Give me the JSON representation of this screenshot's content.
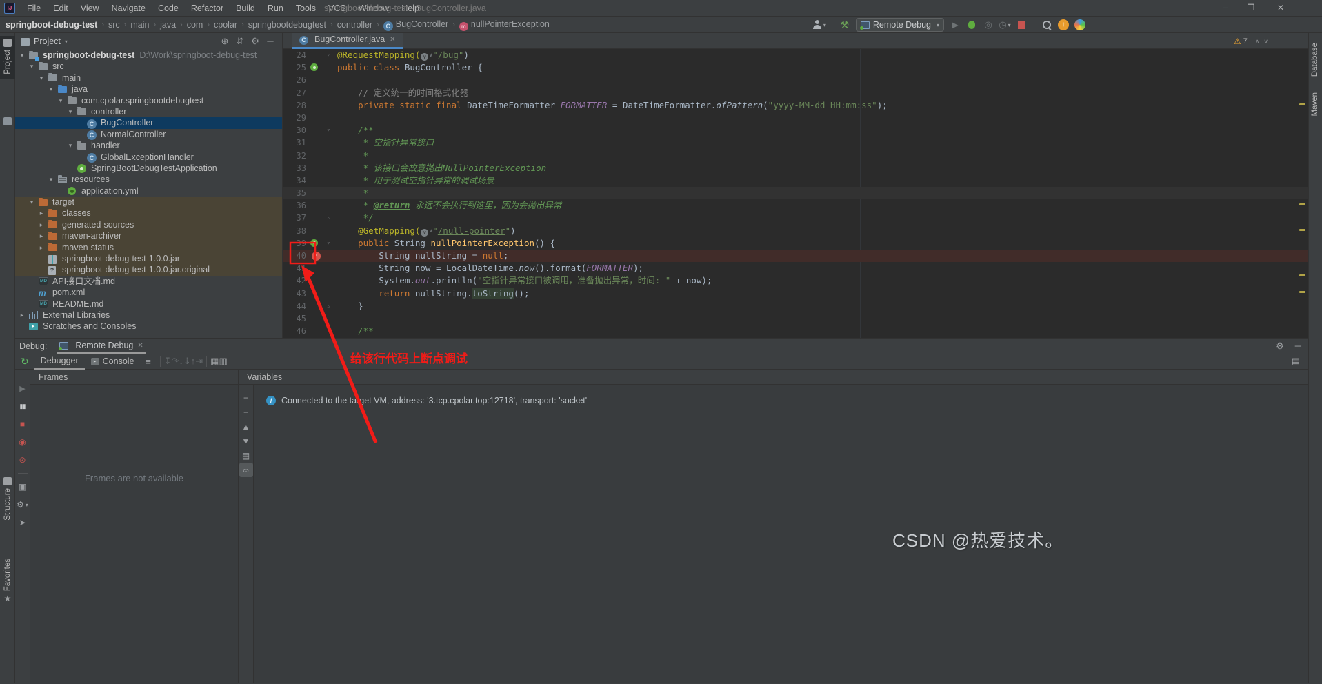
{
  "window": {
    "title": "springboot-debug-test - BugController.java",
    "menus": [
      "File",
      "Edit",
      "View",
      "Navigate",
      "Code",
      "Refactor",
      "Build",
      "Run",
      "Tools",
      "VCS",
      "Window",
      "Help"
    ],
    "controls": {
      "minimize": "─",
      "maximize": "❐",
      "close": "✕"
    }
  },
  "breadcrumbs": [
    {
      "label": "springboot-debug-test",
      "bold": true
    },
    {
      "label": "src"
    },
    {
      "label": "main"
    },
    {
      "label": "java"
    },
    {
      "label": "com"
    },
    {
      "label": "cpolar"
    },
    {
      "label": "springbootdebugtest"
    },
    {
      "label": "controller"
    },
    {
      "label": "BugController",
      "icon": "class"
    },
    {
      "label": "nullPointerException",
      "icon": "method"
    }
  ],
  "toolbar": {
    "run_config": "Remote Debug"
  },
  "left_stripe": {
    "project": "Project",
    "structure": "Structure",
    "favorites": "Favorites"
  },
  "right_stripe": {
    "database": "Database",
    "maven": "Maven"
  },
  "project_panel": {
    "title": "Project",
    "header_icons": [
      {
        "name": "locate-file-icon",
        "glyph": "⊕"
      },
      {
        "name": "collapse-all-icon",
        "glyph": "⇵"
      },
      {
        "name": "panel-settings-icon",
        "glyph": "⚙"
      },
      {
        "name": "hide-panel-icon",
        "glyph": "─"
      }
    ],
    "tree": [
      {
        "label": "springboot-debug-test",
        "suffix": "D:\\Work\\springboot-debug-test",
        "indent": 0,
        "chevron": "open",
        "icon": "project",
        "bold": true
      },
      {
        "label": "src",
        "indent": 1,
        "chevron": "open",
        "icon": "folder"
      },
      {
        "label": "main",
        "indent": 2,
        "chevron": "open",
        "icon": "folder"
      },
      {
        "label": "java",
        "indent": 3,
        "chevron": "open",
        "icon": "folder-src"
      },
      {
        "label": "com.cpolar.springbootdebugtest",
        "indent": 4,
        "chevron": "open",
        "icon": "package"
      },
      {
        "label": "controller",
        "indent": 5,
        "chevron": "open",
        "icon": "package"
      },
      {
        "label": "BugController",
        "indent": 6,
        "icon": "class",
        "selected": true
      },
      {
        "label": "NormalController",
        "indent": 6,
        "icon": "class"
      },
      {
        "label": "handler",
        "indent": 5,
        "chevron": "open",
        "icon": "package"
      },
      {
        "label": "GlobalExceptionHandler",
        "indent": 6,
        "icon": "class"
      },
      {
        "label": "SpringBootDebugTestApplication",
        "indent": 5,
        "icon": "springboot"
      },
      {
        "label": "resources",
        "indent": 3,
        "chevron": "open",
        "icon": "folder-res"
      },
      {
        "label": "application.yml",
        "indent": 4,
        "icon": "yml"
      },
      {
        "label": "target",
        "indent": 1,
        "chevron": "open",
        "icon": "folder-excl",
        "excluded": true
      },
      {
        "label": "classes",
        "indent": 2,
        "chevron": "closed",
        "icon": "folder-excl",
        "excluded": true
      },
      {
        "label": "generated-sources",
        "indent": 2,
        "chevron": "closed",
        "icon": "folder-excl",
        "excluded": true
      },
      {
        "label": "maven-archiver",
        "indent": 2,
        "chevron": "closed",
        "icon": "folder-excl",
        "excluded": true
      },
      {
        "label": "maven-status",
        "indent": 2,
        "chevron": "closed",
        "icon": "folder-excl",
        "excluded": true
      },
      {
        "label": "springboot-debug-test-1.0.0.jar",
        "indent": 2,
        "icon": "jar",
        "excluded": true
      },
      {
        "label": "springboot-debug-test-1.0.0.jar.original",
        "indent": 2,
        "icon": "file-q",
        "excluded": true
      },
      {
        "label": "API接口文档.md",
        "indent": 1,
        "icon": "md"
      },
      {
        "label": "pom.xml",
        "indent": 1,
        "icon": "maven"
      },
      {
        "label": "README.md",
        "indent": 1,
        "icon": "md"
      },
      {
        "label": "External Libraries",
        "indent": 0,
        "chevron": "closed",
        "icon": "libs"
      },
      {
        "label": "Scratches and Consoles",
        "indent": 0,
        "icon": "scratch"
      }
    ]
  },
  "editor": {
    "tab": "BugController.java",
    "inspections": {
      "warning_count": "7"
    },
    "lines": [
      {
        "n": 24,
        "gut": [
          "fold-open"
        ],
        "seg": [
          [
            "ann",
            "@RequestMapping("
          ],
          [
            "ico",
            ""
          ],
          [
            "str",
            "\""
          ],
          [
            "stru",
            "/bug"
          ],
          [
            "str",
            "\""
          ],
          [
            "plain",
            ")"
          ]
        ]
      },
      {
        "n": 25,
        "gut": [
          "spring"
        ],
        "seg": [
          [
            "kw",
            "public class "
          ],
          [
            "plain",
            "BugController {"
          ]
        ]
      },
      {
        "n": 26,
        "seg": []
      },
      {
        "n": 27,
        "seg": [
          [
            "cmt",
            "    // 定义统一的时间格式化器"
          ]
        ]
      },
      {
        "n": 28,
        "seg": [
          [
            "kw",
            "    private static final "
          ],
          [
            "plain",
            "DateTimeFormatter "
          ],
          [
            "field",
            "FORMATTER "
          ],
          [
            "plain",
            "= DateTimeFormatter."
          ],
          [
            "it",
            "ofPattern"
          ],
          [
            "plain",
            "("
          ],
          [
            "str",
            "\"yyyy-MM-dd HH:mm:ss\""
          ],
          [
            "plain",
            ");"
          ]
        ]
      },
      {
        "n": 29,
        "seg": []
      },
      {
        "n": 30,
        "gut": [
          "fold-open"
        ],
        "seg": [
          [
            "doc",
            "    /**"
          ]
        ]
      },
      {
        "n": 31,
        "seg": [
          [
            "doc",
            "     * 空指针异常接口"
          ]
        ]
      },
      {
        "n": 32,
        "seg": [
          [
            "doc",
            "     *"
          ]
        ]
      },
      {
        "n": 33,
        "seg": [
          [
            "doc",
            "     * 该接口会故意抛出NullPointerException"
          ]
        ]
      },
      {
        "n": 34,
        "seg": [
          [
            "doc",
            "     * 用于测试空指针异常的调试场景"
          ]
        ]
      },
      {
        "n": 35,
        "cur": true,
        "seg": [
          [
            "doc",
            "     *"
          ]
        ]
      },
      {
        "n": 36,
        "seg": [
          [
            "doc",
            "     * "
          ],
          [
            "doctag",
            "@return"
          ],
          [
            "doc",
            " 永远不会执行到这里，因为会抛出异常"
          ]
        ]
      },
      {
        "n": 37,
        "gut": [
          "fold-close"
        ],
        "seg": [
          [
            "doc",
            "     */"
          ]
        ]
      },
      {
        "n": 38,
        "seg": [
          [
            "ann",
            "    @GetMapping("
          ],
          [
            "ico",
            ""
          ],
          [
            "str",
            "\""
          ],
          [
            "stru",
            "/null-pointer"
          ],
          [
            "str",
            "\""
          ],
          [
            "plain",
            ")"
          ]
        ]
      },
      {
        "n": 39,
        "gut": [
          "spring",
          "fold-open"
        ],
        "seg": [
          [
            "kw",
            "    public "
          ],
          [
            "plain",
            "String "
          ],
          [
            "meth",
            "nullPointerException"
          ],
          [
            "plain",
            "() {"
          ]
        ]
      },
      {
        "n": 40,
        "bp": true,
        "gut": [
          "bp"
        ],
        "seg": [
          [
            "plain",
            "        String nullString = "
          ],
          [
            "kw",
            "null"
          ],
          [
            "plain",
            ";"
          ]
        ]
      },
      {
        "n": 41,
        "seg": [
          [
            "plain",
            "        String now = LocalDateTime."
          ],
          [
            "it",
            "now"
          ],
          [
            "plain",
            "().format("
          ],
          [
            "field",
            "FORMATTER"
          ],
          [
            "plain",
            ");"
          ]
        ]
      },
      {
        "n": 42,
        "seg": [
          [
            "plain",
            "        System."
          ],
          [
            "field",
            "out"
          ],
          [
            "plain",
            ".println("
          ],
          [
            "str",
            "\"空指针异常接口被调用，准备抛出异常，时间: \""
          ],
          [
            "plain",
            " + now);"
          ]
        ]
      },
      {
        "n": 43,
        "seg": [
          [
            "kw",
            "        return "
          ],
          [
            "plain",
            "nullString."
          ],
          [
            "hl",
            "toString"
          ],
          [
            "plain",
            "();"
          ]
        ]
      },
      {
        "n": 44,
        "gut": [
          "fold-close"
        ],
        "seg": [
          [
            "plain",
            "    }"
          ]
        ]
      },
      {
        "n": 45,
        "seg": []
      },
      {
        "n": 46,
        "seg": [
          [
            "doc",
            "    /**"
          ]
        ]
      }
    ]
  },
  "debug": {
    "label": "Debug:",
    "session_tab": "Remote Debug",
    "tabs": [
      {
        "label": "Debugger",
        "active": true
      },
      {
        "label": "Console",
        "icon": "console"
      }
    ],
    "step_icons": [
      {
        "name": "show-execution-point-icon",
        "glyph": "↧"
      },
      {
        "name": "step-over-icon",
        "glyph": "↷"
      },
      {
        "name": "step-into-icon",
        "glyph": "↓"
      },
      {
        "name": "force-step-into-icon",
        "glyph": "⇣"
      },
      {
        "name": "step-out-icon",
        "glyph": "↑"
      },
      {
        "name": "run-to-cursor-icon",
        "glyph": "⇥"
      }
    ],
    "eval_icons": [
      {
        "name": "evaluate-expression-icon",
        "glyph": "▦"
      },
      {
        "name": "layout-icon",
        "glyph": "▥"
      }
    ],
    "left_toolbar": [
      {
        "name": "resume-icon",
        "glyph": "▶",
        "cls": "g-dim"
      },
      {
        "name": "pause-icon",
        "glyph": "▮▮",
        "cls": "g-white"
      },
      {
        "name": "stop-icon",
        "glyph": "■",
        "cls": "g-red"
      },
      {
        "name": "view-breakpoints-icon",
        "glyph": "◉",
        "cls": "g-red"
      },
      {
        "name": "mute-breakpoints-icon",
        "glyph": "⊘",
        "cls": "g-red"
      },
      {
        "name": "sep"
      },
      {
        "name": "thread-dump-icon",
        "glyph": "▣",
        "cls": "g-grey"
      },
      {
        "name": "debug-settings-icon",
        "glyph": "⚙",
        "cls": "g-grey"
      },
      {
        "name": "pin-icon",
        "glyph": "➤",
        "cls": "g-grey"
      }
    ],
    "frames": {
      "header": "Frames",
      "empty": "Frames are not available"
    },
    "variables": {
      "header": "Variables",
      "stripe_icons": [
        {
          "name": "add-watch-icon",
          "glyph": "+"
        },
        {
          "name": "remove-watch-icon",
          "glyph": "−"
        },
        {
          "name": "move-up-icon",
          "glyph": "▲"
        },
        {
          "name": "move-down-icon",
          "glyph": "▼"
        },
        {
          "name": "duplicate-icon",
          "glyph": "▤"
        },
        {
          "name": "watches-icon",
          "glyph": "∞",
          "active": true
        }
      ],
      "message": "Connected to the target VM, address: '3.tcp.cpolar.top:12718', transport: 'socket'"
    }
  },
  "annotation": {
    "text": "给该行代码上断点调试",
    "color": "#f11c18"
  },
  "watermark": "CSDN @热爱技术。",
  "colors": {
    "accent_blue": "#4a88c7",
    "breakpoint_red": "#d5554d",
    "spring_green": "#5fad3f",
    "annotation_red": "#f11c18"
  }
}
